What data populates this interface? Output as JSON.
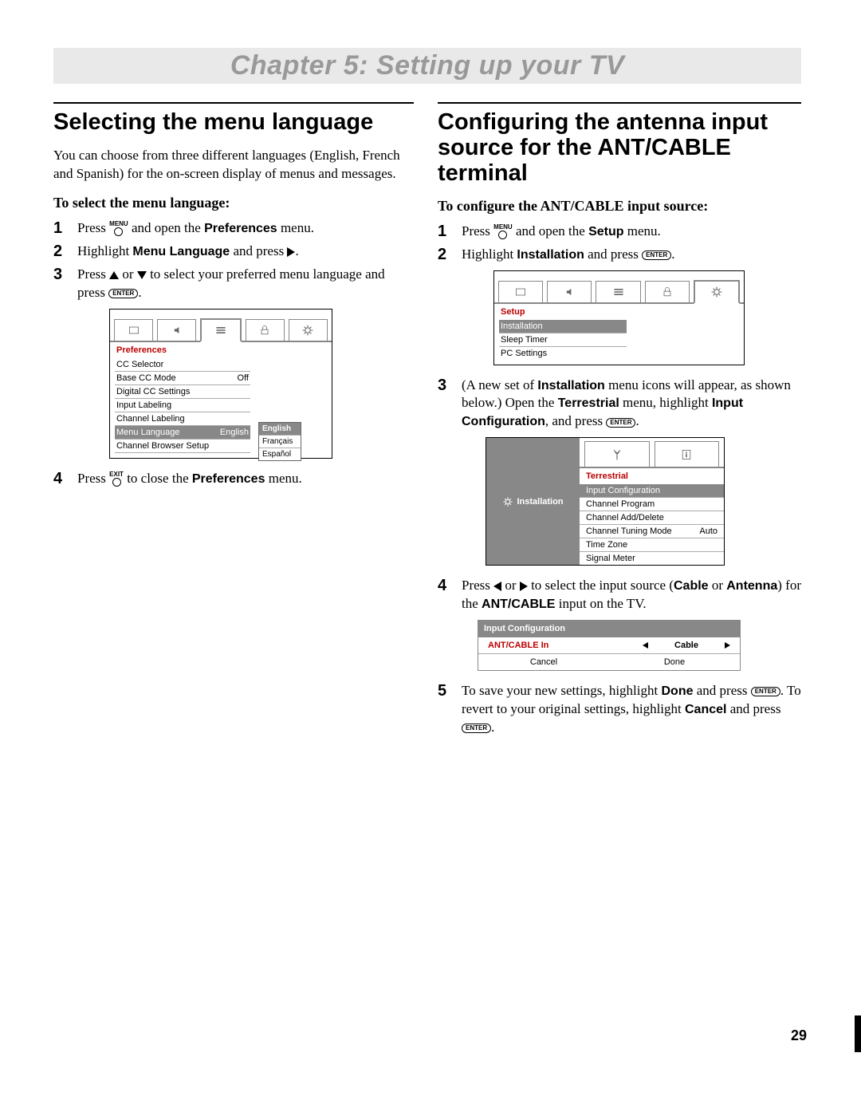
{
  "chapter_title": "Chapter 5: Setting up your TV",
  "page_number": "29",
  "left": {
    "h": "Selecting the menu language",
    "intro": "You can choose from three different languages (English, French and Spanish) for the on-screen display of menus and messages.",
    "sub": "To select the menu language:",
    "s1a": "Press ",
    "s1b": " and open the ",
    "s1c": "Preferences",
    "s1d": " menu.",
    "s2a": "Highlight ",
    "s2b": "Menu Language",
    "s2c": " and press ",
    "s3a": "Press ",
    "s3b": " or ",
    "s3c": " to select your preferred menu language and press ",
    "s4a": "Press ",
    "s4b": " to close the ",
    "s4c": "Preferences",
    "s4d": " menu.",
    "menu_btn": "MENU",
    "exit_btn": "EXIT",
    "enter_btn": "ENTER"
  },
  "pref_osd": {
    "title": "Preferences",
    "rows": {
      "cc": "CC Selector",
      "base": "Base CC Mode",
      "base_val": "Off",
      "dig": "Digital CC Settings",
      "inlab": "Input Labeling",
      "chlab": "Channel Labeling",
      "mlang": "Menu Language",
      "mlang_val": "English",
      "cbs": "Channel Browser Setup"
    },
    "popup": {
      "en": "English",
      "fr": "Français",
      "es": "Español"
    }
  },
  "right": {
    "h": "Configuring the antenna input source for the ANT/CABLE terminal",
    "sub": "To configure the ANT/CABLE input source:",
    "s1a": "Press ",
    "s1b": " and open the ",
    "s1c": "Setup",
    "s1d": " menu.",
    "s2a": "Highlight ",
    "s2b": "Installation",
    "s2c": " and press ",
    "s3a": "(A new set of ",
    "s3b": "Installation",
    "s3c": " menu icons will appear, as shown below.) Open the ",
    "s3d": "Terrestrial",
    "s3e": " menu, highlight ",
    "s3f": "Input Configuration",
    "s3g": ", and press ",
    "s4a": "Press ",
    "s4b": " or ",
    "s4c": " to select the input source (",
    "s4d": "Cable",
    "s4e": " or ",
    "s4f": "Antenna",
    "s4g": ") for the ",
    "s4h": "ANT/CABLE",
    "s4i": " input on the TV.",
    "s5a": "To save your new settings, highlight ",
    "s5b": "Done",
    "s5c": " and press ",
    "s5d": ". To revert to your original settings, highlight ",
    "s5e": "Cancel",
    "s5f": " and press ",
    "menu_btn": "MENU",
    "enter_btn": "ENTER"
  },
  "setup_osd": {
    "title": "Setup",
    "r1": "Installation",
    "r2": "Sleep Timer",
    "r3": "PC Settings"
  },
  "install_osd": {
    "side": "Installation",
    "title": "Terrestrial",
    "r1": "Input Configuration",
    "r2": "Channel Program",
    "r3": "Channel Add/Delete",
    "r4": "Channel Tuning Mode",
    "r4v": "Auto",
    "r5": "Time Zone",
    "r6": "Signal Meter"
  },
  "inconf_osd": {
    "title": "Input Configuration",
    "label": "ANT/CABLE In",
    "val": "Cable",
    "cancel": "Cancel",
    "done": "Done"
  },
  "nums": {
    "n1": "1",
    "n2": "2",
    "n3": "3",
    "n4": "4",
    "n5": "5"
  }
}
